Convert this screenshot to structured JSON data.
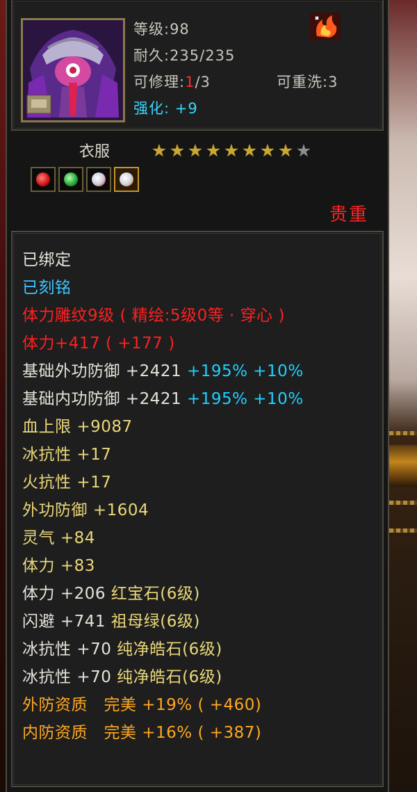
{
  "header": {
    "level": "等级:98",
    "durability": "耐久:235/235",
    "repair_prefix": "可修理:",
    "repair_current": "1",
    "repair_suffix": "/3",
    "rewash": "可重洗:3",
    "enhance_label": "强化:",
    "enhance_value": "+9"
  },
  "item": {
    "type": "衣服",
    "stars_total": 9,
    "stars_filled": 8,
    "rarity": "贵重",
    "gem_icons": [
      "red-gem-icon",
      "green-gem-icon",
      "white-gem-icon",
      "white-gem-gold-frame-icon"
    ]
  },
  "attributes": {
    "bound": "已绑定",
    "engraved": "已刻铭",
    "carving": "体力雕纹9级 ( 精绘:5级0等 · 穿心 )",
    "stamina_main": "体力+417 ( +177 )",
    "basic_outer_def": {
      "label": "基础外功防御",
      "value": "+2421",
      "pct1": "+195%",
      "pct2": "+10%"
    },
    "basic_inner_def": {
      "label": "基础内功防御",
      "value": "+2421",
      "pct1": "+195%",
      "pct2": "+10%"
    },
    "stats": [
      {
        "label": "血上限",
        "value": "+9087"
      },
      {
        "label": "冰抗性",
        "value": "+17"
      },
      {
        "label": "火抗性",
        "value": "+17"
      },
      {
        "label": "外功防御",
        "value": "+1604"
      },
      {
        "label": "灵气",
        "value": "+84"
      },
      {
        "label": "体力",
        "value": "+83"
      }
    ],
    "gems": [
      {
        "label": "体力",
        "value": "+206",
        "gem": "红宝石(6级)"
      },
      {
        "label": "闪避",
        "value": "+741",
        "gem": "祖母绿(6级)"
      },
      {
        "label": "冰抗性",
        "value": "+70",
        "gem": "纯净皓石(6级)"
      },
      {
        "label": "冰抗性",
        "value": "+70",
        "gem": "纯净皓石(6级)"
      }
    ],
    "qualities": [
      {
        "label": "外防资质",
        "grade": "完美",
        "pct": "+19%",
        "bonus": "( +460)"
      },
      {
        "label": "内防资质",
        "grade": "完美",
        "pct": "+16%",
        "bonus": "( +387)"
      }
    ]
  },
  "colors": {
    "red": "#ff2020",
    "blue": "#3ec4ff",
    "yellow": "#ead87a",
    "orange": "#ffa821",
    "cyan": "#1fd0ff"
  }
}
